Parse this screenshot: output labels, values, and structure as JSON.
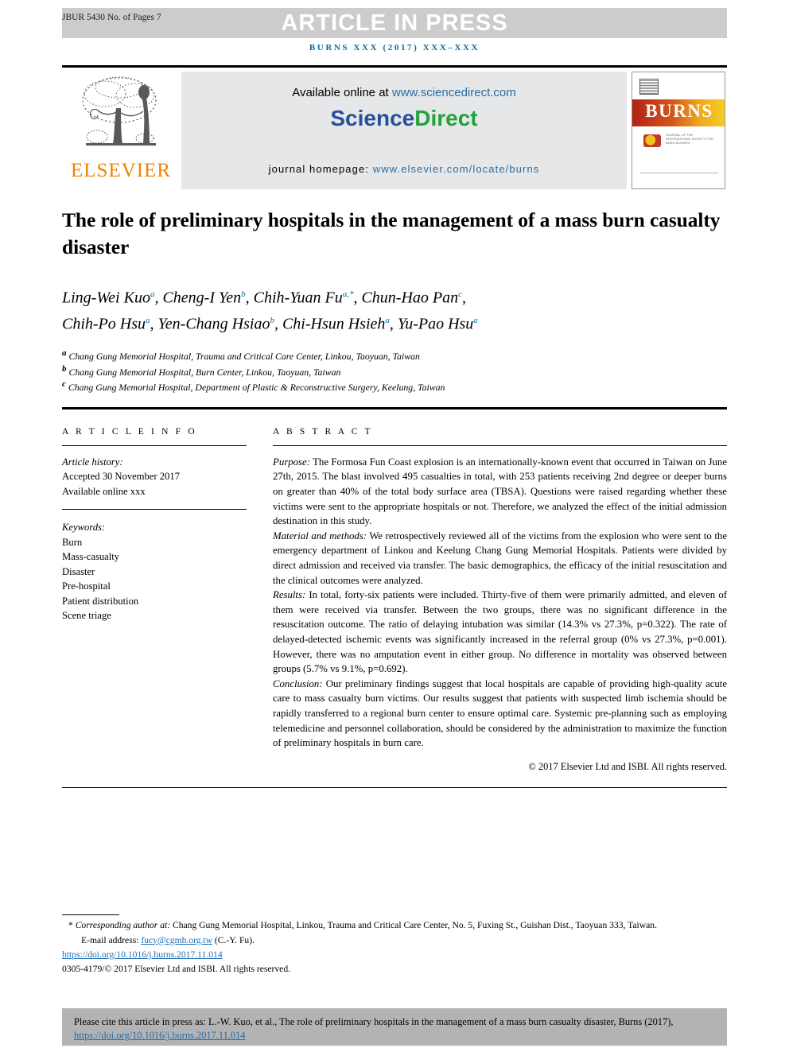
{
  "banner": {
    "jbur_label": "JBUR 5430 No. of Pages 7",
    "article_in_press": "ARTICLE IN PRESS",
    "journal_ref": "BURNS XXX (2017) XXX–XXX"
  },
  "masthead": {
    "elsevier_wordmark": "ELSEVIER",
    "available_prefix": "Available online at ",
    "sciencedirect_url": "www.sciencedirect.com",
    "sciencedirect_logo_part1": "Science",
    "sciencedirect_logo_part2": "Direct",
    "homepage_prefix": "journal homepage: ",
    "homepage_url": "www.elsevier.com/locate/burns",
    "cover_title": "BURNS",
    "cover_society": "JOURNAL OF THE INTERNATIONAL SOCIETY FOR BURN INJURIES"
  },
  "article": {
    "title": "The role of preliminary hospitals in the management of a mass burn casualty disaster",
    "authors_line1": "Ling-Wei Kuo<sup>a</sup>, Cheng-I Yen<sup>b</sup>, Chih-Yuan Fu<sup>a,*</sup>, Chun-Hao Pan<sup>c</sup>,",
    "authors_line2": "Chih-Po Hsu<sup>a</sup>, Yen-Chang Hsiao<sup>b</sup>, Chi-Hsun Hsieh<sup>a</sup>, Yu-Pao Hsu<sup>a</sup>",
    "affiliations": [
      "<sup>a</sup> Chang Gung Memorial Hospital, Trauma and Critical Care Center, Linkou, Taoyuan, Taiwan",
      "<sup>b</sup> Chang Gung Memorial Hospital, Burn Center, Linkou, Taoyuan, Taiwan",
      "<sup>c</sup> Chang Gung Memorial Hospital, Department of Plastic &amp; Reconstructive Surgery, Keelung, Taiwan"
    ]
  },
  "article_info": {
    "heading": "A R T I C L E  I N F O",
    "history_label": "Article history:",
    "history_lines": [
      "Accepted 30 November 2017",
      "Available online xxx"
    ],
    "keywords_label": "Keywords:",
    "keywords": [
      "Burn",
      "Mass-casualty",
      "Disaster",
      "Pre-hospital",
      "Patient distribution",
      "Scene triage"
    ]
  },
  "abstract": {
    "heading": "A B S T R A C T",
    "sections": [
      {
        "label": "Purpose:",
        "text": " The Formosa Fun Coast explosion is an internationally-known event that occurred in Taiwan on June 27th, 2015. The blast involved 495 casualties in total, with 253 patients receiving 2nd degree or deeper burns on greater than 40% of the total body surface area (TBSA). Questions were raised regarding whether these victims were sent to the appropriate hospitals or not. Therefore, we analyzed the effect of the initial admission destination in this study."
      },
      {
        "label": "Material and methods:",
        "text": " We retrospectively reviewed all of the victims from the explosion who were sent to the emergency department of Linkou and Keelung Chang Gung Memorial Hospitals. Patients were divided by direct admission and received via transfer. The basic demographics, the efficacy of the initial resuscitation and the clinical outcomes were analyzed."
      },
      {
        "label": "Results:",
        "text": " In total, forty-six patients were included. Thirty-five of them were primarily admitted, and eleven of them were received via transfer. Between the two groups, there was no significant difference in the resuscitation outcome. The ratio of delaying intubation was similar (14.3% vs 27.3%, p=0.322). The rate of delayed-detected ischemic events was significantly increased in the referral group (0% vs 27.3%, p=0.001). However, there was no amputation event in either group. No difference in mortality was observed between groups (5.7% vs 9.1%, p=0.692)."
      },
      {
        "label": "Conclusion:",
        "text": " Our preliminary findings suggest that local hospitals are capable of providing high-quality acute care to mass casualty burn victims. Our results suggest that patients with suspected limb ischemia should be rapidly transferred to a regional burn center to ensure optimal care. Systemic pre-planning such as employing telemedicine and personnel collaboration, should be considered by the administration to maximize the function of preliminary hospitals in burn care."
      }
    ],
    "copyright": "© 2017 Elsevier Ltd and ISBI. All rights reserved."
  },
  "footnotes": {
    "corresponding_marker": "*",
    "corresponding_label": "Corresponding author at:",
    "corresponding_text": " Chang Gung Memorial Hospital, Linkou, Trauma and Critical Care Center, No. 5, Fuxing St., Guishan Dist., Taoyuan 333, Taiwan.",
    "email_label": "E-mail address:",
    "email_address": "fucy@cgmh.org.tw",
    "email_suffix": " (C.-Y. Fu).",
    "doi": "https://doi.org/10.1016/j.burns.2017.11.014",
    "issn_line": "0305-4179/© 2017 Elsevier Ltd and ISBI. All rights reserved."
  },
  "citation_box": {
    "text_before_link": "Please cite this article in press as: L.-W. Kuo, et al., The role of preliminary hospitals in the management of a mass burn casualty disaster, Burns (2017), ",
    "link": "https://doi.org/10.1016/j.burns.2017.11.014"
  },
  "colors": {
    "link_blue": "#2b6ca3",
    "journal_ref_blue": "#0a6b9a",
    "elsevier_orange": "#ef8200",
    "sciencedirect_green": "#21a23b",
    "banner_grey": "#cccccc",
    "citation_grey": "#b3b3b3"
  }
}
